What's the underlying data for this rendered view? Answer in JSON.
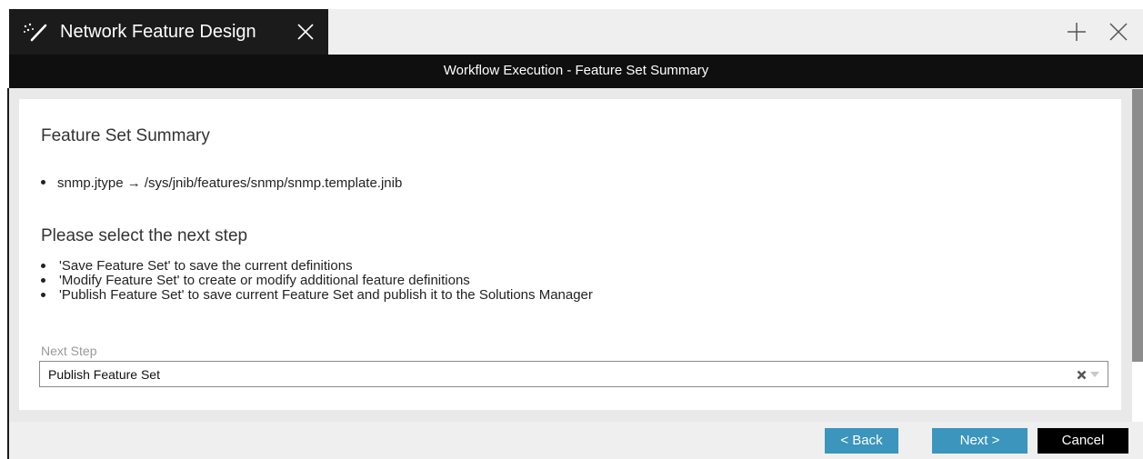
{
  "tab": {
    "icon": "magic-wand-icon",
    "title": "Network Feature Design",
    "close_icon": "close-icon",
    "add_icon": "plus-icon",
    "window_close_icon": "close-icon"
  },
  "header": {
    "title": "Workflow Execution - Feature Set Summary"
  },
  "summary": {
    "heading": "Feature Set Summary",
    "items": [
      "snmp.jtype → /sys/jnib/features/snmp/snmp.template.jnib"
    ]
  },
  "next_step_info": {
    "heading": "Please select the next step",
    "options": [
      "'Save Feature Set' to save the current definitions",
      "'Modify Feature Set' to create or modify additional feature definitions",
      "'Publish Feature Set' to save current Feature Set and publish it to the Solutions Manager"
    ]
  },
  "next_step_field": {
    "label": "Next Step",
    "value": "Publish Feature Set"
  },
  "footer": {
    "back_label": "< Back",
    "next_label": "Next >",
    "cancel_label": "Cancel"
  },
  "colors": {
    "tab_bg": "#1b1b1b",
    "header_bg": "#0f0f0f",
    "button_blue": "#3b95bd",
    "button_black": "#000000",
    "workarea_bg": "#e9e9e9"
  }
}
